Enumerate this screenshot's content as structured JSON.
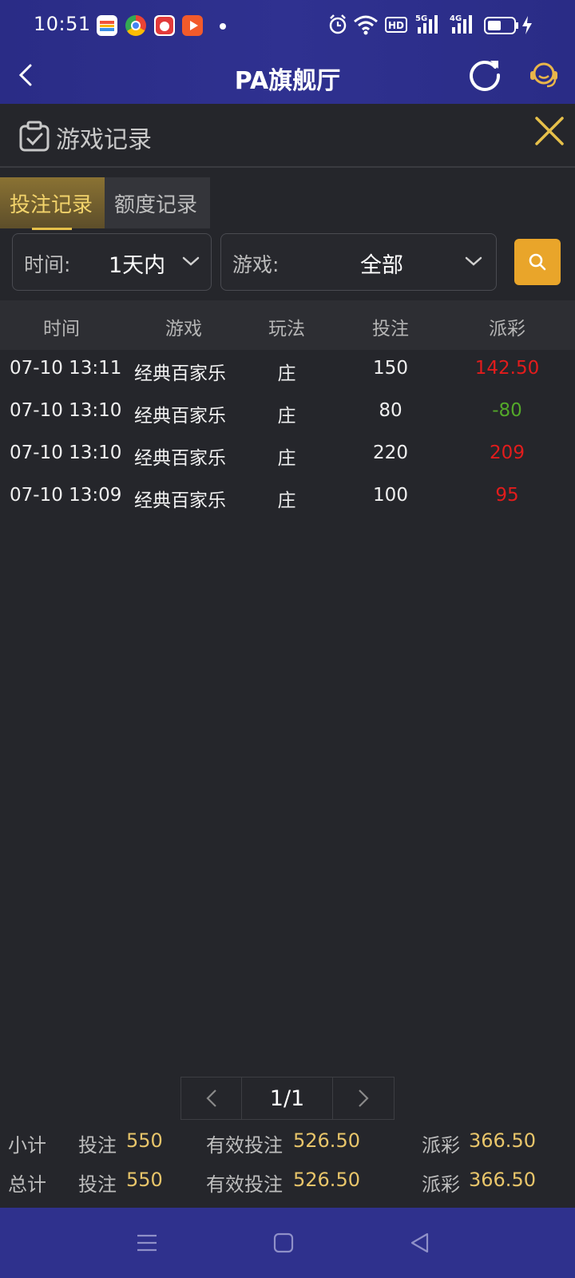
{
  "status_bar": {
    "time": "10:51",
    "icons": [
      "wallet-app-icon",
      "chrome-app-icon",
      "game-app-icon",
      "video-app-icon",
      "alarm-icon",
      "wifi-icon",
      "hd-icon",
      "signal-5g-icon",
      "signal-4g-icon",
      "battery-icon",
      "charging-icon"
    ],
    "network_5g": "5G",
    "network_4g": "4G",
    "hd_label": "HD"
  },
  "app_bar": {
    "title": "PA旗舰厅"
  },
  "panel": {
    "title": "游戏记录"
  },
  "tabs": [
    {
      "label": "投注记录",
      "active": true
    },
    {
      "label": "额度记录",
      "active": false
    }
  ],
  "filters": {
    "time_label": "时间:",
    "time_value": "1天内",
    "game_label": "游戏:",
    "game_value": "全部"
  },
  "table": {
    "headers": [
      "时间",
      "游戏",
      "玩法",
      "投注",
      "派彩"
    ],
    "rows": [
      {
        "time": "07-10 13:11",
        "game": "经典百家乐",
        "play": "庄",
        "bet": "150",
        "payout": "142.50"
      },
      {
        "time": "07-10 13:10",
        "game": "经典百家乐",
        "play": "庄",
        "bet": "80",
        "payout": "-80"
      },
      {
        "time": "07-10 13:10",
        "game": "经典百家乐",
        "play": "庄",
        "bet": "220",
        "payout": "209"
      },
      {
        "time": "07-10 13:09",
        "game": "经典百家乐",
        "play": "庄",
        "bet": "100",
        "payout": "95"
      }
    ]
  },
  "pagination": {
    "info": "1/1"
  },
  "summary": {
    "subtotal": {
      "label": "小计",
      "bet_key": "投注",
      "bet": "550",
      "valid_key": "有效投注",
      "valid": "526.50",
      "payout_key": "派彩",
      "payout": "366.50"
    },
    "total": {
      "label": "总计",
      "bet_key": "投注",
      "bet": "550",
      "valid_key": "有效投注",
      "valid": "526.50",
      "payout_key": "派彩",
      "payout": "366.50"
    }
  },
  "colors": {
    "accent_gold": "#e9a52a",
    "positive": "#e21c1c",
    "negative": "#53a829",
    "header_bg": "#2f3190"
  }
}
